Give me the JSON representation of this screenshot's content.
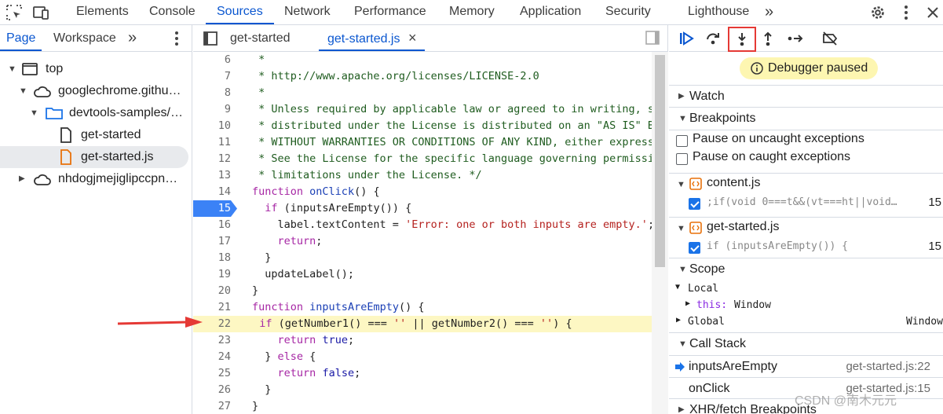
{
  "toolbar": {
    "tabs": [
      "Elements",
      "Console",
      "Sources",
      "Network",
      "Performance",
      "Memory",
      "Application",
      "Security",
      "Lighthouse"
    ],
    "active_tab": "Sources",
    "more_label": "»"
  },
  "navigator": {
    "tabs": [
      "Page",
      "Workspace"
    ],
    "more_label": "»",
    "tree": [
      {
        "label": "top",
        "icon": "frame-icon"
      },
      {
        "label": "googlechrome.githu…",
        "icon": "cloud-icon"
      },
      {
        "label": "devtools-samples/…",
        "icon": "folder-icon"
      },
      {
        "label": "get-started",
        "icon": "file-icon"
      },
      {
        "label": "get-started.js",
        "icon": "js-file-icon"
      },
      {
        "label": "nhdogjmejiglipccpn…",
        "icon": "cloud-icon"
      }
    ]
  },
  "editor": {
    "tabs": [
      "get-started",
      "get-started.js"
    ],
    "active_tab": "get-started.js",
    "close_label": "×",
    "breakpoint_line": "15",
    "paused_line": "22",
    "lines": [
      {
        "n": "6",
        "t": " *"
      },
      {
        "n": "7",
        "t": " * http://www.apache.org/licenses/LICENSE-2.0"
      },
      {
        "n": "8",
        "t": " *"
      },
      {
        "n": "9",
        "t": " * Unless required by applicable law or agreed to in writing, sc"
      },
      {
        "n": "10",
        "t": " * distributed under the License is distributed on an \"AS IS\" BA"
      },
      {
        "n": "11",
        "t": " * WITHOUT WARRANTIES OR CONDITIONS OF ANY KIND, either express"
      },
      {
        "n": "12",
        "t": " * See the License for the specific language governing permissic"
      },
      {
        "n": "13",
        "t": " * limitations under the License. */"
      },
      {
        "n": "14",
        "t": "function onClick() {"
      },
      {
        "n": "15",
        "t": "  if (inputsAreEmpty()) {"
      },
      {
        "n": "16",
        "t": "    label.textContent = 'Error: one or both inputs are empty.';"
      },
      {
        "n": "17",
        "t": "    return;"
      },
      {
        "n": "18",
        "t": "  }"
      },
      {
        "n": "19",
        "t": "  updateLabel();"
      },
      {
        "n": "20",
        "t": "}"
      },
      {
        "n": "21",
        "t": "function inputsAreEmpty() {"
      },
      {
        "n": "22",
        "t": "  if (getNumber1() === '' || getNumber2() === '') {"
      },
      {
        "n": "23",
        "t": "    return true;"
      },
      {
        "n": "24",
        "t": "  } else {"
      },
      {
        "n": "25",
        "t": "    return false;"
      },
      {
        "n": "26",
        "t": "  }"
      },
      {
        "n": "27",
        "t": "}"
      }
    ]
  },
  "debugger": {
    "status": "Debugger paused",
    "sections": {
      "watch": "Watch",
      "breakpoints": "Breakpoints",
      "scope": "Scope",
      "call_stack": "Call Stack",
      "xhr": "XHR/fetch Breakpoints"
    },
    "pause_uncaught": "Pause on uncaught exceptions",
    "pause_caught": "Pause on caught exceptions",
    "bp_files": [
      {
        "file": "content.js",
        "code": ";if(void 0===t&&(vt===ht||void…",
        "line": "15"
      },
      {
        "file": "get-started.js",
        "code": "if (inputsAreEmpty()) {",
        "line": "15"
      }
    ],
    "scope": {
      "local": "Local",
      "this_key": "this:",
      "this_val": "Window",
      "global": "Global",
      "global_val": "Window"
    },
    "call_stack": [
      {
        "fn": "inputsAreEmpty",
        "loc": "get-started.js:22"
      },
      {
        "fn": "onClick",
        "loc": "get-started.js:15"
      }
    ]
  },
  "watermark": "CSDN @南木元元",
  "colors": {
    "accent": "#0b57d0",
    "paused_line": "#fdf7c3",
    "highlight_box": "#e53935",
    "arrow": "#e53935"
  }
}
